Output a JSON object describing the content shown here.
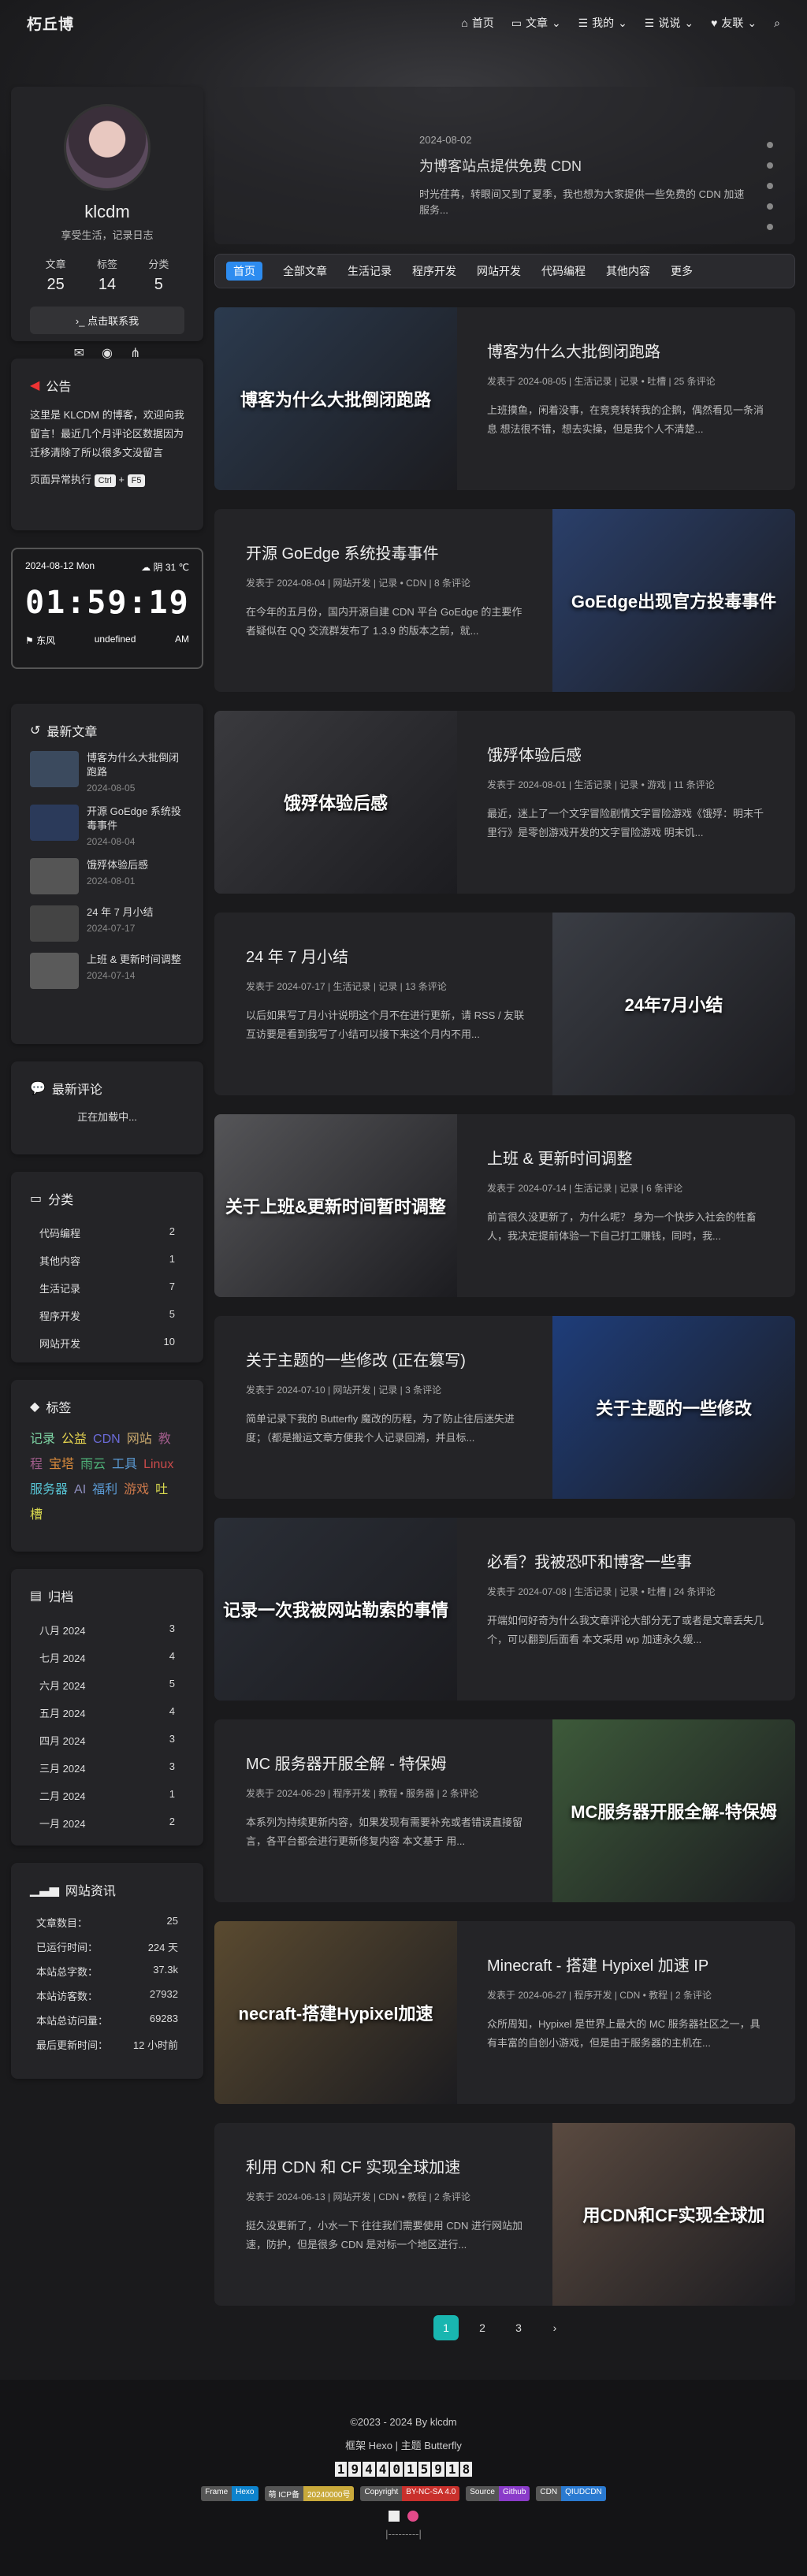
{
  "nav": {
    "brand": "朽丘博",
    "items": [
      "首页",
      "文章",
      "我的",
      "说说",
      "友联"
    ]
  },
  "profile": {
    "name": "klcdm",
    "desc": "享受生活，记录日志",
    "stats": [
      {
        "l": "文章",
        "v": "25"
      },
      {
        "l": "标签",
        "v": "14"
      },
      {
        "l": "分类",
        "v": "5"
      }
    ],
    "contact": "点击联系我"
  },
  "notice": {
    "title": "公告",
    "text": "这里是 KLCDM 的博客，欢迎向我留言！最近几个月评论区数据因为迁移清除了所以很多文没留言",
    "hint": "页面异常执行",
    "k1": "Ctrl",
    "plus": "+",
    "k2": "F5"
  },
  "clock": {
    "date": "2024-08-12 Mon",
    "weather": "阴 31 ℃",
    "time": "01:59:19",
    "city": "东风",
    "status": "undefined",
    "ampm": "AM"
  },
  "recent": {
    "title": "最新文章",
    "items": [
      {
        "t": "博客为什么大批倒闭跑路",
        "d": "2024-08-05",
        "c": "#3b4a5e"
      },
      {
        "t": "开源 GoEdge 系统投毒事件",
        "d": "2024-08-04",
        "c": "#2b3a5a"
      },
      {
        "t": "饿殍体验后感",
        "d": "2024-08-01",
        "c": "#555"
      },
      {
        "t": "24 年 7 月小结",
        "d": "2024-07-17",
        "c": "#444"
      },
      {
        "t": "上班 & 更新时间调整",
        "d": "2024-07-14",
        "c": "#5a5a5a"
      }
    ]
  },
  "comments": {
    "title": "最新评论",
    "loading": "正在加载中..."
  },
  "categories": {
    "title": "分类",
    "items": [
      {
        "n": "代码编程",
        "c": "2"
      },
      {
        "n": "其他内容",
        "c": "1"
      },
      {
        "n": "生活记录",
        "c": "7"
      },
      {
        "n": "程序开发",
        "c": "5"
      },
      {
        "n": "网站开发",
        "c": "10"
      }
    ]
  },
  "tags": {
    "title": "标签",
    "items": [
      {
        "n": "记录",
        "c": "#7ed6a5"
      },
      {
        "n": "公益",
        "c": "#e5d44f"
      },
      {
        "n": "CDN",
        "c": "#6b6bd9"
      },
      {
        "n": "网站",
        "c": "#c9a96e"
      },
      {
        "n": "教程",
        "c": "#a05c8a"
      },
      {
        "n": "宝塔",
        "c": "#d98a3b"
      },
      {
        "n": "雨云",
        "c": "#4fb37a"
      },
      {
        "n": "工具",
        "c": "#5b9bd5"
      },
      {
        "n": "Linux",
        "c": "#c94a4a"
      },
      {
        "n": "服务器",
        "c": "#58c4d4"
      },
      {
        "n": "AI",
        "c": "#8f8fbf"
      },
      {
        "n": "福利",
        "c": "#5b9bd5"
      },
      {
        "n": "游戏",
        "c": "#c9774a"
      },
      {
        "n": "吐槽",
        "c": "#d9d94f"
      }
    ]
  },
  "archives": {
    "title": "归档",
    "items": [
      {
        "n": "八月 2024",
        "c": "3"
      },
      {
        "n": "七月 2024",
        "c": "4"
      },
      {
        "n": "六月 2024",
        "c": "5"
      },
      {
        "n": "五月 2024",
        "c": "4"
      },
      {
        "n": "四月 2024",
        "c": "3"
      },
      {
        "n": "三月 2024",
        "c": "3"
      },
      {
        "n": "二月 2024",
        "c": "1"
      },
      {
        "n": "一月 2024",
        "c": "2"
      }
    ]
  },
  "siteinfo": {
    "title": "网站资讯",
    "items": [
      {
        "n": "文章数目：",
        "c": "25"
      },
      {
        "n": "已运行时间：",
        "c": "224 天"
      },
      {
        "n": "本站总字数：",
        "c": "37.3k"
      },
      {
        "n": "本站访客数：",
        "c": "27932"
      },
      {
        "n": "本站总访问量：",
        "c": "69283"
      },
      {
        "n": "最后更新时间：",
        "c": "12 小时前"
      }
    ]
  },
  "banner": {
    "date": "2024-08-02",
    "title": "为博客站点提供免费 CDN",
    "excerpt": "时光荏苒，转眼间又到了夏季，我也想为大家提供一些免费的 CDN 加速服务..."
  },
  "catbar": [
    "首页",
    "全部文章",
    "生活记录",
    "程序开发",
    "网站开发",
    "代码编程",
    "其他内容",
    "更多"
  ],
  "posts": [
    {
      "title": "博客为什么大批倒闭跑路",
      "meta": "发表于 2024-08-05 | 生活记录 | 记录 • 吐槽 | 25 条评论",
      "ex": "上班摸鱼，闲着没事，在竞竞转转我的企鹅，偶然看见一条消息 想法很不错，想去实操，但是我个人不清楚...",
      "img": "博客为什么大批倒闭跑路",
      "bg": "#2b3a4e",
      "left": true
    },
    {
      "title": "开源 GoEdge 系统投毒事件",
      "meta": "发表于 2024-08-04 | 网站开发 | 记录 • CDN | 8 条评论",
      "ex": "在今年的五月份，国内开源自建 CDN 平台 GoEdge 的主要作者疑似在 QQ 交流群发布了 1.3.9 的版本之前，就...",
      "img": "GoEdge出现官方投毒事件",
      "bg": "#2a3f6a",
      "left": false
    },
    {
      "title": "饿殍体验后感",
      "meta": "发表于 2024-08-01 | 生活记录 | 记录 • 游戏 | 11 条评论",
      "ex": "最近，迷上了一个文字冒险剧情文字冒险游戏《饿殍：明末千里行》是零创游戏开发的文字冒险游戏 明末饥...",
      "img": "饿殍体验后感",
      "bg": "#3a3a3e",
      "left": true
    },
    {
      "title": "24 年 7 月小结",
      "meta": "发表于 2024-07-17 | 生活记录 | 记录 | 13 条评论",
      "ex": "以后如果写了月小计说明这个月不在进行更新，请 RSS / 友联互访要是看到我写了小结可以接下来这个月内不用...",
      "img": "24年7月小结",
      "bg": "#3a3d44",
      "left": false
    },
    {
      "title": "上班 & 更新时间调整",
      "meta": "发表于 2024-07-14 | 生活记录 | 记录 | 6 条评论",
      "ex": "前言很久没更新了，为什么呢？ 身为一个快步入社会的牲畜人，我决定提前体验一下自己打工赚钱，同时，我...",
      "img": "关于上班&更新时间暂时调整",
      "bg": "#555558",
      "left": true
    },
    {
      "title": "关于主题的一些修改 (正在篡写)",
      "meta": "发表于 2024-07-10 | 网站开发 | 记录 | 3 条评论",
      "ex": "简单记录下我的 Butterfly 魔改的历程，为了防止往后迷失进度；（都是搬运文章方便我个人记录回溯，并且标...",
      "img": "关于主题的一些修改",
      "bg": "#1e3d7a",
      "left": false
    },
    {
      "title": "必看？我被恐吓和博客一些事",
      "meta": "发表于 2024-07-08 | 生活记录 | 记录 • 吐槽 | 24 条评论",
      "ex": "开端如何好奇为什么我文章评论大部分无了或者是文章丢失几个，可以翻到后面看 本文采用 wp 加速永久缓...",
      "img": "记录一次我被网站勒索的事情",
      "bg": "#2a2e36",
      "left": true
    },
    {
      "title": "MC 服务器开服全解 - 特保姆",
      "meta": "发表于 2024-06-29 | 程序开发 | 教程 • 服务器 | 2 条评论",
      "ex": "本系列为持续更新内容，如果发现有需要补充或者错误直接留言，各平台都会进行更新修复内容 本文基于 用...",
      "img": "MC服务器开服全解-特保姆",
      "bg": "#3d5a3a",
      "left": false
    },
    {
      "title": "Minecraft - 搭建 Hypixel 加速 IP",
      "meta": "发表于 2024-06-27 | 程序开发 | CDN • 教程 | 2 条评论",
      "ex": "众所周知，Hypixel 是世界上最大的 MC 服务器社区之一，具有丰富的自创小游戏，但是由于服务器的主机在...",
      "img": "necraft-搭建Hypixel加速",
      "bg": "#5a4a30",
      "left": true
    },
    {
      "title": "利用 CDN 和 CF 实现全球加速",
      "meta": "发表于 2024-06-13 | 网站开发 | CDN • 教程 | 2 条评论",
      "ex": "挺久没更新了，小水一下 往往我们需要使用 CDN 进行网站加速，防护，但是很多 CDN 是对标一个地区进行...",
      "img": "用CDN和CF实现全球加",
      "bg": "#5a4a40",
      "left": false
    }
  ],
  "pager": [
    "1",
    "2",
    "3",
    "›"
  ],
  "footer": {
    "copy": "©2023 - 2024 By klcdm",
    "frame": "框架 Hexo | 主题 Butterfly",
    "counter": [
      "1",
      "9",
      "4",
      "4",
      "0",
      "1",
      "5",
      "9",
      "1",
      "8"
    ],
    "badges": [
      {
        "a": "Frame",
        "b": "Hexo",
        "c": "#0e83cd"
      },
      {
        "a": "萌 ICP备",
        "b": "20240000号",
        "c": "#c9a93b"
      },
      {
        "a": "Copyright",
        "b": "BY-NC-SA 4.0",
        "c": "#c9302c"
      },
      {
        "a": "Source",
        "b": "Github",
        "c": "#8a3bc9"
      },
      {
        "a": "CDN",
        "b": "QIUDCDN",
        "c": "#2a7ad1"
      }
    ]
  }
}
